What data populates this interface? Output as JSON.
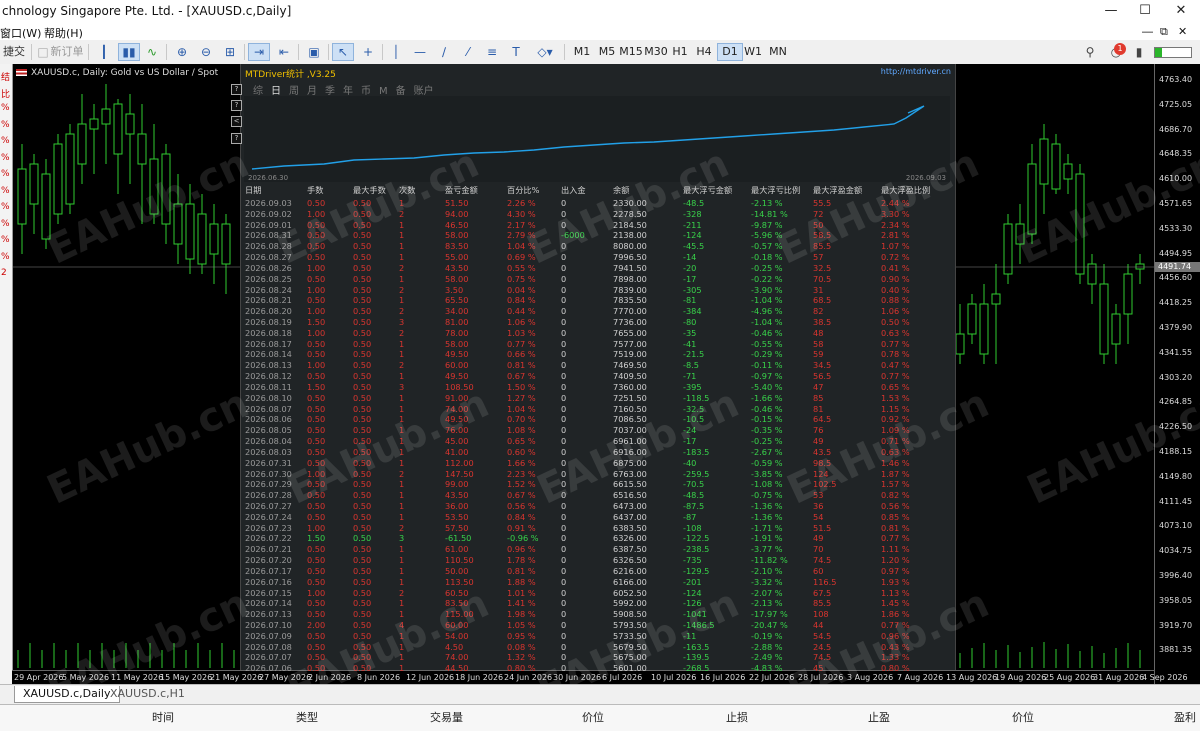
{
  "window": {
    "title": "chnology Singapore Pte. Ltd. - [XAUUSD.c,Daily]",
    "controls": [
      "—",
      "☐",
      "✕"
    ]
  },
  "menu": {
    "items": [
      "窗口(W)",
      "帮助(H)"
    ],
    "mdi_controls": [
      "―",
      "⧉",
      "✕"
    ]
  },
  "toolbar": {
    "trade_label": "捷交易",
    "new_order_label": "新订单",
    "timeframes": [
      "M1",
      "M5",
      "M15",
      "M30",
      "H1",
      "H4",
      "D1",
      "W1",
      "MN"
    ],
    "selected_timeframe": "D1",
    "notification_count": "1"
  },
  "chart": {
    "symbol_title": "XAUUSD.c, Daily:  Gold vs US Dollar / Spot",
    "left_strip": [
      "结",
      "比",
      "%",
      "%",
      "%",
      "%",
      "%",
      "%",
      "%",
      "%",
      "%",
      "%",
      "2"
    ],
    "price_labels": [
      "4763.40",
      "4725.05",
      "4686.70",
      "4648.35",
      "4610.00",
      "4571.65",
      "4533.30",
      "4494.95",
      "4456.60",
      "4418.25",
      "4379.90",
      "4341.55",
      "4303.20",
      "4264.85",
      "4226.50",
      "4188.15",
      "4149.80",
      "4111.45",
      "4073.10",
      "4034.75",
      "3996.40",
      "3958.05",
      "3919.70",
      "3881.35"
    ],
    "current_price": "4491.74",
    "date_labels": [
      "29 Apr 2026",
      "5 May 2026",
      "11 May 2026",
      "15 May 2026",
      "21 May 2026",
      "27 May 2026",
      "2 Jun 2026",
      "8 Jun 2026",
      "12 Jun 2026",
      "18 Jun 2026",
      "24 Jun 2026",
      "30 Jun 2026",
      "6 Jul 2026",
      "10 Jul 2026",
      "16 Jul 2026",
      "22 Jul 2026",
      "28 Jul 2026",
      "3 Aug 2026",
      "7 Aug 2026",
      "13 Aug 2026",
      "19 Aug 2026",
      "25 Aug 2026",
      "31 Aug 2026",
      "4 Sep 2026"
    ],
    "watermark": "EAHub.cn",
    "up_color": "#ffffff",
    "down_color": "#000000",
    "candle_outline": "#2fcc2f"
  },
  "panel": {
    "title": "MTDriver统计 ,V3.25",
    "url": "http://mtdriver.cn",
    "tabs": [
      "综",
      "日",
      "周",
      "月",
      "季",
      "年",
      "币",
      "M",
      "备",
      "账户"
    ],
    "active_tab": "日",
    "side_buttons": [
      "?",
      "?",
      "<",
      "?"
    ],
    "equity_start_date": "2026.06.30",
    "equity_end_date": "2026.09.03",
    "columns": [
      "日期",
      "手数",
      "最大手数",
      "次数",
      "盈亏金额",
      "百分比%",
      "出入金",
      "余额",
      "最大浮亏金额",
      "最大浮亏比例",
      "最大浮盈金额",
      "最大浮盈比例"
    ],
    "rows": [
      [
        "2026.09.03",
        "0.50",
        "0.50",
        "1",
        "51.50",
        "2.26 %",
        "0",
        "2330.00",
        "-48.5",
        "-2.13 %",
        "55.5",
        "2.44 %"
      ],
      [
        "2026.09.02",
        "1.00",
        "0.50",
        "2",
        "94.00",
        "4.30 %",
        "0",
        "2278.50",
        "-328",
        "-14.81 %",
        "72",
        "3.30 %"
      ],
      [
        "2026.09.01",
        "0.50",
        "0.50",
        "1",
        "46.50",
        "2.17 %",
        "0",
        "2184.50",
        "-211",
        "-9.87 %",
        "50",
        "2.34 %"
      ],
      [
        "2026.08.31",
        "0.50",
        "0.50",
        "1",
        "58.00",
        "2.79 %",
        "-6000",
        "2138.00",
        "-124",
        "-5.96 %",
        "58.5",
        "2.81 %"
      ],
      [
        "2026.08.28",
        "0.50",
        "0.50",
        "1",
        "83.50",
        "1.04 %",
        "0",
        "8080.00",
        "-45.5",
        "-0.57 %",
        "85.5",
        "1.07 %"
      ],
      [
        "2026.08.27",
        "0.50",
        "0.50",
        "1",
        "55.00",
        "0.69 %",
        "0",
        "7996.50",
        "-14",
        "-0.18 %",
        "57",
        "0.72 %"
      ],
      [
        "2026.08.26",
        "1.00",
        "0.50",
        "2",
        "43.50",
        "0.55 %",
        "0",
        "7941.50",
        "-20",
        "-0.25 %",
        "32.5",
        "0.41 %"
      ],
      [
        "2026.08.25",
        "0.50",
        "0.50",
        "1",
        "58.00",
        "0.75 %",
        "0",
        "7898.00",
        "-17",
        "-0.22 %",
        "70.5",
        "0.90 %"
      ],
      [
        "2026.08.24",
        "1.00",
        "0.50",
        "2",
        "3.50",
        "0.04 %",
        "0",
        "7839.00",
        "-305",
        "-3.90 %",
        "31",
        "0.40 %"
      ],
      [
        "2026.08.21",
        "0.50",
        "0.50",
        "1",
        "65.50",
        "0.84 %",
        "0",
        "7835.50",
        "-81",
        "-1.04 %",
        "68.5",
        "0.88 %"
      ],
      [
        "2026.08.20",
        "1.00",
        "0.50",
        "2",
        "34.00",
        "0.44 %",
        "0",
        "7770.00",
        "-384",
        "-4.96 %",
        "82",
        "1.06 %"
      ],
      [
        "2026.08.19",
        "1.50",
        "0.50",
        "3",
        "81.00",
        "1.06 %",
        "0",
        "7736.00",
        "-80",
        "-1.04 %",
        "38.5",
        "0.50 %"
      ],
      [
        "2026.08.18",
        "1.00",
        "0.50",
        "2",
        "78.00",
        "1.03 %",
        "0",
        "7655.00",
        "-35",
        "-0.46 %",
        "48",
        "0.63 %"
      ],
      [
        "2026.08.17",
        "0.50",
        "0.50",
        "1",
        "58.00",
        "0.77 %",
        "0",
        "7577.00",
        "-41",
        "-0.55 %",
        "58",
        "0.77 %"
      ],
      [
        "2026.08.14",
        "0.50",
        "0.50",
        "1",
        "49.50",
        "0.66 %",
        "0",
        "7519.00",
        "-21.5",
        "-0.29 %",
        "59",
        "0.78 %"
      ],
      [
        "2026.08.13",
        "1.00",
        "0.50",
        "2",
        "60.00",
        "0.81 %",
        "0",
        "7469.50",
        "-8.5",
        "-0.11 %",
        "34.5",
        "0.47 %"
      ],
      [
        "2026.08.12",
        "0.50",
        "0.50",
        "1",
        "49.50",
        "0.67 %",
        "0",
        "7409.50",
        "-71",
        "-0.97 %",
        "56.5",
        "0.77 %"
      ],
      [
        "2026.08.11",
        "1.50",
        "0.50",
        "3",
        "108.50",
        "1.50 %",
        "0",
        "7360.00",
        "-395",
        "-5.40 %",
        "47",
        "0.65 %"
      ],
      [
        "2026.08.10",
        "0.50",
        "0.50",
        "1",
        "91.00",
        "1.27 %",
        "0",
        "7251.50",
        "-118.5",
        "-1.66 %",
        "85",
        "1.53 %"
      ],
      [
        "2026.08.07",
        "0.50",
        "0.50",
        "1",
        "74.00",
        "1.04 %",
        "0",
        "7160.50",
        "-32.5",
        "-0.46 %",
        "81",
        "1.15 %"
      ],
      [
        "2026.08.06",
        "0.50",
        "0.50",
        "1",
        "49.50",
        "0.70 %",
        "0",
        "7086.50",
        "-10.5",
        "-0.15 %",
        "64.5",
        "0.92 %"
      ],
      [
        "2026.08.05",
        "0.50",
        "0.50",
        "1",
        "76.00",
        "1.08 %",
        "0",
        "7037.00",
        "-24",
        "-0.35 %",
        "76",
        "1.09 %"
      ],
      [
        "2026.08.04",
        "0.50",
        "0.50",
        "1",
        "45.00",
        "0.65 %",
        "0",
        "6961.00",
        "-17",
        "-0.25 %",
        "49",
        "0.71 %"
      ],
      [
        "2026.08.03",
        "0.50",
        "0.50",
        "1",
        "41.00",
        "0.60 %",
        "0",
        "6916.00",
        "-183.5",
        "-2.67 %",
        "43.5",
        "0.63 %"
      ],
      [
        "2026.07.31",
        "0.50",
        "0.50",
        "1",
        "112.00",
        "1.66 %",
        "0",
        "6875.00",
        "-40",
        "-0.59 %",
        "98.5",
        "1.46 %"
      ],
      [
        "2026.07.30",
        "1.00",
        "0.50",
        "2",
        "147.50",
        "2.23 %",
        "0",
        "6763.00",
        "-259.5",
        "-3.85 %",
        "124",
        "1.87 %"
      ],
      [
        "2026.07.29",
        "0.50",
        "0.50",
        "1",
        "99.00",
        "1.52 %",
        "0",
        "6615.50",
        "-70.5",
        "-1.08 %",
        "102.5",
        "1.57 %"
      ],
      [
        "2026.07.28",
        "0.50",
        "0.50",
        "1",
        "43.50",
        "0.67 %",
        "0",
        "6516.50",
        "-48.5",
        "-0.75 %",
        "53",
        "0.82 %"
      ],
      [
        "2026.07.27",
        "0.50",
        "0.50",
        "1",
        "36.00",
        "0.56 %",
        "0",
        "6473.00",
        "-87.5",
        "-1.36 %",
        "36",
        "0.56 %"
      ],
      [
        "2026.07.24",
        "0.50",
        "0.50",
        "1",
        "53.50",
        "0.84 %",
        "0",
        "6437.00",
        "-87",
        "-1.36 %",
        "54",
        "0.85 %"
      ],
      [
        "2026.07.23",
        "1.00",
        "0.50",
        "2",
        "57.50",
        "0.91 %",
        "0",
        "6383.50",
        "-108",
        "-1.71 %",
        "51.5",
        "0.81 %"
      ],
      [
        "2026.07.22",
        "1.50",
        "0.50",
        "3",
        "-61.50",
        "-0.96 %",
        "0",
        "6326.00",
        "-122.5",
        "-1.91 %",
        "49",
        "0.77 %"
      ],
      [
        "2026.07.21",
        "0.50",
        "0.50",
        "1",
        "61.00",
        "0.96 %",
        "0",
        "6387.50",
        "-238.5",
        "-3.77 %",
        "70",
        "1.11 %"
      ],
      [
        "2026.07.20",
        "0.50",
        "0.50",
        "1",
        "110.50",
        "1.78 %",
        "0",
        "6326.50",
        "-735",
        "-11.82 %",
        "74.5",
        "1.20 %"
      ],
      [
        "2026.07.17",
        "0.50",
        "0.50",
        "1",
        "50.00",
        "0.81 %",
        "0",
        "6216.00",
        "-129.5",
        "-2.10 %",
        "60",
        "0.97 %"
      ],
      [
        "2026.07.16",
        "0.50",
        "0.50",
        "1",
        "113.50",
        "1.88 %",
        "0",
        "6166.00",
        "-201",
        "-3.32 %",
        "116.5",
        "1.93 %"
      ],
      [
        "2026.07.15",
        "1.00",
        "0.50",
        "2",
        "60.50",
        "1.01 %",
        "0",
        "6052.50",
        "-124",
        "-2.07 %",
        "67.5",
        "1.13 %"
      ],
      [
        "2026.07.14",
        "0.50",
        "0.50",
        "1",
        "83.50",
        "1.41 %",
        "0",
        "5992.00",
        "-126",
        "-2.13 %",
        "85.5",
        "1.45 %"
      ],
      [
        "2026.07.13",
        "0.50",
        "0.50",
        "1",
        "115.00",
        "1.98 %",
        "0",
        "5908.50",
        "-1041",
        "-17.97 %",
        "108",
        "1.86 %"
      ],
      [
        "2026.07.10",
        "2.00",
        "0.50",
        "4",
        "60.00",
        "1.05 %",
        "0",
        "5793.50",
        "-1486.5",
        "-20.47 %",
        "44",
        "0.77 %"
      ],
      [
        "2026.07.09",
        "0.50",
        "0.50",
        "1",
        "54.00",
        "0.95 %",
        "0",
        "5733.50",
        "-11",
        "-0.19 %",
        "54.5",
        "0.96 %"
      ],
      [
        "2026.07.08",
        "0.50",
        "0.50",
        "1",
        "4.50",
        "0.08 %",
        "0",
        "5679.50",
        "-163.5",
        "-2.88 %",
        "24.5",
        "0.43 %"
      ],
      [
        "2026.07.07",
        "0.50",
        "0.50",
        "1",
        "74.00",
        "1.32 %",
        "0",
        "5675.00",
        "-139.5",
        "-2.49 %",
        "74.5",
        "1.33 %"
      ],
      [
        "2026.07.06",
        "0.50",
        "0.50",
        "1",
        "44.50",
        "0.80 %",
        "0",
        "5601.00",
        "-268.5",
        "-4.83 %",
        "45",
        "0.80 %"
      ]
    ]
  },
  "chart_tabs": {
    "items": [
      "XAUUSD.c,Daily",
      "XAUUSD.c,H1"
    ],
    "active": "XAUUSD.c,Daily"
  },
  "terminal": {
    "columns": [
      "时间",
      "类型",
      "交易量",
      "价位",
      "止损",
      "止盈",
      "价位",
      "盈利"
    ]
  }
}
